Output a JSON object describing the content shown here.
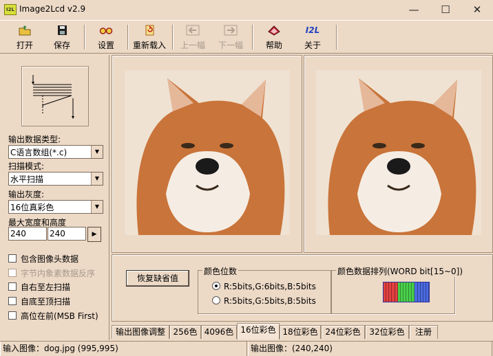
{
  "window": {
    "title": "Image2Lcd v2.9",
    "app_icon": "I2L",
    "minimize": "—",
    "maximize": "☐",
    "close": "✕"
  },
  "toolbar": {
    "open": "打开",
    "save": "保存",
    "settings": "设置",
    "reload": "重新载入",
    "prev": "上一幅",
    "next": "下一幅",
    "help": "帮助",
    "about": "关于",
    "about_icon": "I2L"
  },
  "left": {
    "output_type_label": "输出数据类型:",
    "output_type_value": "C语言数组(*.c)",
    "scan_mode_label": "扫描模式:",
    "scan_mode_value": "水平扫描",
    "gray_label": "输出灰度:",
    "gray_value": "16位真彩色",
    "max_size_label": "最大宽度和高度",
    "width": "240",
    "height": "240",
    "apply_arrow": "▶",
    "checkboxes": [
      {
        "label": "包含图像头数据",
        "enabled": true,
        "checked": false
      },
      {
        "label": "字节内象素数据反序",
        "enabled": false,
        "checked": false
      },
      {
        "label": "自右至左扫描",
        "enabled": true,
        "checked": false
      },
      {
        "label": "自底至顶扫描",
        "enabled": true,
        "checked": false
      },
      {
        "label": "高位在前(MSB First)",
        "enabled": true,
        "checked": false
      }
    ]
  },
  "bottom": {
    "restore_button": "恢复缺省值",
    "color_bits_legend": "颜色位数",
    "radio1": "R:5bits,G:6bits,B:5bits",
    "radio2": "R:5bits,G:5bits,B:5bits",
    "selected_radio": 1,
    "color_order_legend": "颜色数据排列(WORD bit[15~0])",
    "color_order_bits": [
      "#e24040",
      "#e24040",
      "#e24040",
      "#e24040",
      "#e24040",
      "#4ad04a",
      "#4ad04a",
      "#4ad04a",
      "#4ad04a",
      "#4ad04a",
      "#4ad04a",
      "#4a6ae0",
      "#4a6ae0",
      "#4a6ae0",
      "#4a6ae0",
      "#4a6ae0"
    ]
  },
  "tabs": [
    "输出图像调整",
    "256色",
    "4096色",
    "16位彩色",
    "18位彩色",
    "24位彩色",
    "32位彩色",
    "注册"
  ],
  "active_tab": 3,
  "status": {
    "input": "输入图像：dog.jpg (995,995)",
    "output": "输出图像：(240,240)"
  },
  "colors": {
    "face_bg": "#ecd9c6",
    "shadow": "#a08a74"
  }
}
